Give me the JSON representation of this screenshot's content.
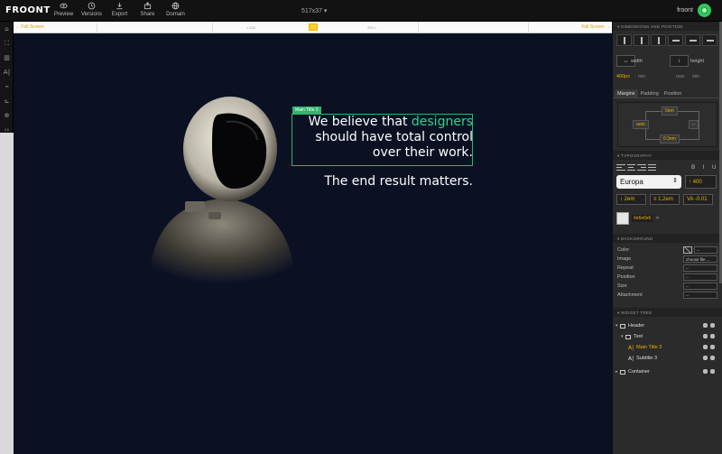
{
  "app": {
    "logo": "FROONT",
    "viewport_label": "517x37 ▾",
    "user": "froont"
  },
  "nav": [
    {
      "label": "Preview",
      "icon": "eye-icon"
    },
    {
      "label": "Versions",
      "icon": "history-icon"
    },
    {
      "label": "Export",
      "icon": "download-icon"
    },
    {
      "label": "Share",
      "icon": "share-icon"
    },
    {
      "label": "Domain",
      "icon": "globe-icon"
    }
  ],
  "ruler": {
    "left": "← Full Screen",
    "right": "Full Screen →",
    "mark_left": "≈ 320",
    "mark_right": "320 ≈"
  },
  "canvas": {
    "headline_before": "We believe that ",
    "headline_accent": "designers",
    "headline_after": " should have total control over their work.",
    "subtitle": "The end result matters.",
    "selection_tag": "Main Title 3"
  },
  "panel": {
    "dimensions": {
      "title": "DIMENSIONS AND POSITION",
      "width_label": "width",
      "height_label": "height",
      "width_value": "400px",
      "width_min": "min",
      "height_max": "max",
      "height_min": "min"
    },
    "tabs": [
      "Margins",
      "Padding",
      "Position"
    ],
    "box": {
      "top": "0em",
      "left": "auto",
      "right": "--",
      "bottom": "0.3em"
    },
    "typography": {
      "title": "TYPOGRAPHY",
      "font": "Europa",
      "weight": "↑ 400",
      "size": "↕ 2em",
      "line_height": "≡ 1.2em",
      "letter_spacing": "VA -0.01",
      "color_hex": "#e6e6e6",
      "bold": "B",
      "italic": "I",
      "underline": "U"
    },
    "background": {
      "title": "BACKGROUND",
      "rows": [
        {
          "label": "Color",
          "value": "--"
        },
        {
          "label": "Image",
          "value": "choose file ..."
        },
        {
          "label": "Repeat",
          "value": "--"
        },
        {
          "label": "Position",
          "value": "--"
        },
        {
          "label": "Size",
          "value": "--"
        },
        {
          "label": "Attachment",
          "value": "--"
        }
      ]
    },
    "tree": {
      "title": "WIDGET TREE",
      "items": [
        {
          "label": "Header"
        },
        {
          "label": "Text"
        },
        {
          "label": "Main Title 3"
        },
        {
          "label": "Subtitle 3"
        },
        {
          "label": "Container"
        }
      ]
    }
  },
  "colors": {
    "accent": "#2fd58a",
    "selection": "#2fb56c",
    "highlight": "#e6b400",
    "canvas_bg": "#0b1123"
  }
}
